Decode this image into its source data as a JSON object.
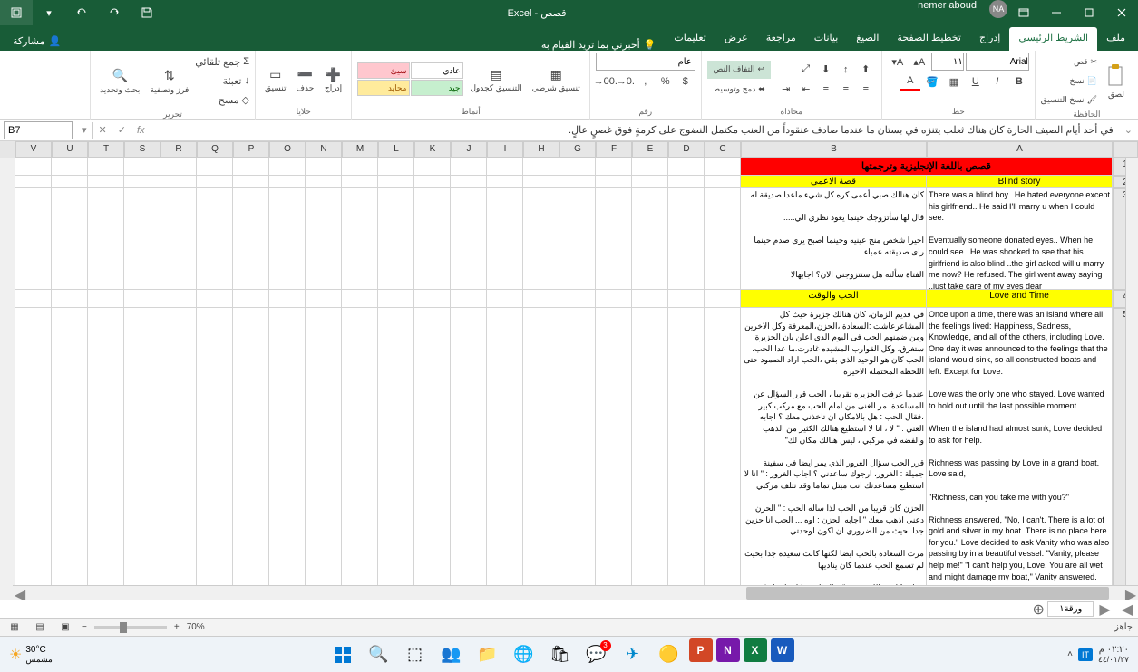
{
  "titlebar": {
    "user_initials": "NA",
    "user_name": "nemer aboud",
    "title": "قصص - Excel"
  },
  "tabs": {
    "file": "ملف",
    "home": "الشريط الرئيسي",
    "insert": "إدراج",
    "pagelayout": "تخطيط الصفحة",
    "formulas": "الصيغ",
    "data": "بيانات",
    "review": "مراجعة",
    "view": "عرض",
    "help": "تعليمات",
    "tellme": "أخبرني بما تريد القيام به",
    "share": "مشاركة"
  },
  "ribbon": {
    "clipboard": {
      "label": "الحافظة",
      "paste": "لصق",
      "cut": "قص",
      "copy": "نسخ",
      "formatpainter": "نسخ التنسيق"
    },
    "font": {
      "label": "خط",
      "name": "Arial",
      "size": "١١"
    },
    "alignment": {
      "label": "محاذاة",
      "wrap": "التفاف النص",
      "merge": "دمج وتوسيط"
    },
    "number": {
      "label": "رقم",
      "format": "عام"
    },
    "styles": {
      "label": "أنماط",
      "cond": "تنسيق شرطي",
      "table": "التنسيق كجدول",
      "cellstyle_normal": "عادي",
      "cellstyle_bad": "سيئ",
      "cellstyle_good": "جيد",
      "cellstyle_neutral": "محايد"
    },
    "cells": {
      "label": "خلايا",
      "insert": "إدراج",
      "delete": "حذف",
      "format": "تنسيق"
    },
    "editing": {
      "label": "تحرير",
      "autosum": "جمع تلقائي",
      "fill": "تعبئة",
      "clear": "مسح",
      "sort": "فرز وتصفية",
      "find": "بحث وتحديد"
    }
  },
  "formula": {
    "cell_ref": "B7",
    "content": "في أحد أيام الصيف الحارة كان هناك ثعلب يتنزه في بستان ما عندما صادف عنقوداً من العنب مكتمل النضوج على كرمةٍ فوق غصنٍ عالٍ."
  },
  "columns_visible": [
    "A",
    "B",
    "C",
    "D",
    "E",
    "F",
    "G",
    "H",
    "I",
    "J",
    "K",
    "L",
    "M",
    "N",
    "O",
    "P",
    "Q",
    "R",
    "S",
    "T",
    "U",
    "V"
  ],
  "col_widths": {
    "A": 205,
    "B": 205,
    "other": 40
  },
  "rows": {
    "1": {
      "A_B": "قصص باللغة الإنجليزية وترجمتها"
    },
    "2": {
      "A": "Blind story",
      "B": "قصة الاعمى"
    },
    "3": {
      "A": "There was a blind boy.. He hated everyone except his girlfriend.. He said I'll marry u when I could see.\n\nEventually someone donated eyes.. When he could see.. He was shocked to see that his girlfriend is also blind ..the girl asked will u marry me now? He refused. The girl went away saying ..just take care of my eyes dear",
      "B": "كان هنالك صبي أعمى كره كل شيء ماعدا صديقة له\n\nقال لها سأتزوجك حينما يعود نظري الي.....\n\nاخيرا شخص منح عينيه وحينما اصبح يرى صدم حينما راى صديقته عمياء\n\nالفتاة سألته هل ستتزوجني الان؟ اجابهالا\n\nالفتاة ذهبت وهي تقول فقط اعتني بعيوني يا عزيزي"
    },
    "4": {
      "A": "Love and Time",
      "B": "الحب والوقت"
    },
    "5": {
      "A": "Once upon a time, there was an island where all the feelings lived: Happiness, Sadness, Knowledge, and all of the others, including Love. One day it was announced to the feelings that the island would sink, so all constructed boats and left. Except for Love.\n\nLove was the only one who stayed. Love wanted to hold out until the last possible moment.\n\nWhen the island had almost sunk, Love decided to ask for help.\n\nRichness was passing by Love in a grand boat. Love said,\n\n\"Richness, can you take me with you?\"\n\nRichness answered, \"No, I can't. There is a lot of gold and silver in my boat. There is no place here for you.\" Love decided to ask Vanity who was also passing by in a beautiful vessel. \"Vanity, please help me!\" \"I can't help you, Love. You are all wet and might damage my boat,\" Vanity answered.\n\nSadness was close by so Love asked, \"Sadness, let me go with you.\" \"Oh . . . Love, I am so sad that I need to be by myself!\"",
      "B": "في قديم الزمان، كان هنالك جزيرة حيث كل المشاعرعاشت :السعادة ،الحزن،المعرفة وكل الاخرين ومن ضمنهم الحب في اليوم الذي اعلن بان الجزيرة ستغرق، وكل القوارب المشيده غادرت.ما عدا الحب. الحب كان هو الوحيد الذي بقي ،الحب اراد الصمود حتى اللحظة المحتملة الاخيرة\n\nعندما عرفت الجزيره تقريبا ، الحب قرر السؤال عن المساعدة. مر الغنى من امام الحب مع مركب كبير ،فقال الحب : هل بالامكان ان تاخذني معك ؟ اجابه الغني : \" لا ، انا لا استطيع هنالك الكثير من الذهب والفضه في مركبي ، ليس هنالك مكان لك\"\n\nقرر الحب سؤال الغرور الذي يمر ايضا في سفينة جميلة : الغرور، ارجوك ساعدني ؟ اجاب الغرور : \" انا لا استطيع مساعدتك انت مبتل تماما وقد تتلف مركبي\n\nالحزن كان قريبا من الحب لذا ساله الحب : \" الحزن دعني اذهب معك \" اجابه الحزن : اوه ... الحب انا حزين جدا بحيث من الضروري ان اكون لوحدتي\n\nمرت السعادة بالحب ايضا لكنها كانت سعيدة جدا بحيث لم تسمع الحب عندما كان يناديها\n\nفجاءة كان هنالك صوت \" تعال الحب انا ساخذك \" هو كان شيخا كبيرا متواضعا، حتى الحب نسي ان يسال الشيخ اين هم سيذهبون ؟\n\nعندما وصلو الى اليابسة سار الشيخ في طريقه الخاص . وادراكه كم كان يدين للشيخ"
    }
  },
  "row_heights": {
    "1": 20,
    "2": 14,
    "3": 112,
    "4": 20,
    "5": 320
  },
  "sheet": {
    "name": "ورقة١"
  },
  "status": {
    "ready": "جاهز",
    "zoom": "70%"
  },
  "taskbar": {
    "weather_temp": "30°C",
    "weather_label": "مشمس",
    "time": "٠٢:٢٠ م",
    "date": "٤٤/٠١/٢٧"
  }
}
